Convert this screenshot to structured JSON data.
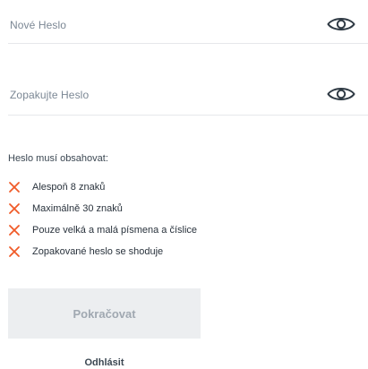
{
  "form": {
    "new_password_placeholder": "Nové Heslo",
    "repeat_password_placeholder": "Zopakujte Heslo"
  },
  "requirements": {
    "title": "Heslo musí obsahovat:",
    "items": [
      {
        "label": "Alespoň 8 znaků",
        "status": "failed",
        "icon": "close-icon"
      },
      {
        "label": "Maximálně 30 znaků",
        "status": "failed",
        "icon": "close-icon"
      },
      {
        "label": "Pouze velká a malá písmena a číslice",
        "status": "failed",
        "icon": "close-icon"
      },
      {
        "label": "Zopakované heslo se shoduje",
        "status": "failed",
        "icon": "close-icon"
      }
    ]
  },
  "actions": {
    "continue_label": "Pokračovat",
    "continue_disabled": true,
    "logout_label": "Odhlásit"
  },
  "icons": {
    "visibility": "eye-icon"
  },
  "colors": {
    "error_x": "#f05a28",
    "eye_icon": "#2f3a44",
    "disabled_button_bg": "#eceef0",
    "disabled_button_text": "#a0a8b1",
    "placeholder": "#7b8794",
    "body_text": "#29323c",
    "divider": "#e6e8eb"
  }
}
